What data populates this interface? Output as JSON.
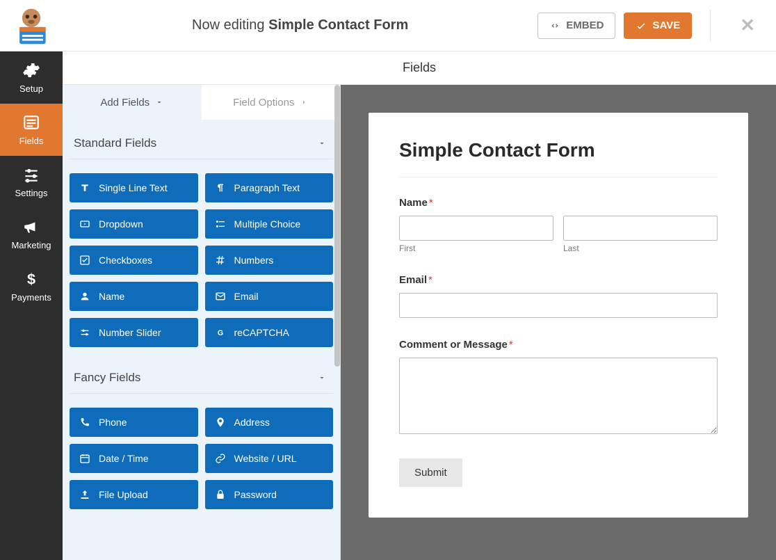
{
  "header": {
    "editing_prefix": "Now editing",
    "form_name": "Simple Contact Form",
    "embed_label": "EMBED",
    "save_label": "SAVE"
  },
  "vnav": {
    "items": [
      {
        "label": "Setup"
      },
      {
        "label": "Fields"
      },
      {
        "label": "Settings"
      },
      {
        "label": "Marketing"
      },
      {
        "label": "Payments"
      }
    ],
    "active_index": 1
  },
  "subheader": {
    "title": "Fields"
  },
  "side": {
    "tabs": [
      {
        "label": "Add Fields"
      },
      {
        "label": "Field Options"
      }
    ],
    "active_tab": 0,
    "groups": [
      {
        "title": "Standard Fields",
        "fields": [
          {
            "label": "Single Line Text",
            "icon": "text-icon"
          },
          {
            "label": "Paragraph Text",
            "icon": "paragraph-icon"
          },
          {
            "label": "Dropdown",
            "icon": "dropdown-icon"
          },
          {
            "label": "Multiple Choice",
            "icon": "list-icon"
          },
          {
            "label": "Checkboxes",
            "icon": "check-icon"
          },
          {
            "label": "Numbers",
            "icon": "hash-icon"
          },
          {
            "label": "Name",
            "icon": "user-icon"
          },
          {
            "label": "Email",
            "icon": "mail-icon"
          },
          {
            "label": "Number Slider",
            "icon": "slider-icon"
          },
          {
            "label": "reCAPTCHA",
            "icon": "g-icon"
          }
        ]
      },
      {
        "title": "Fancy Fields",
        "fields": [
          {
            "label": "Phone",
            "icon": "phone-icon"
          },
          {
            "label": "Address",
            "icon": "pin-icon"
          },
          {
            "label": "Date / Time",
            "icon": "calendar-icon"
          },
          {
            "label": "Website / URL",
            "icon": "link-icon"
          },
          {
            "label": "File Upload",
            "icon": "upload-icon"
          },
          {
            "label": "Password",
            "icon": "lock-icon"
          }
        ]
      }
    ]
  },
  "preview": {
    "form_title": "Simple Contact Form",
    "name": {
      "label": "Name",
      "first_sub": "First",
      "last_sub": "Last",
      "required": true,
      "first_value": "",
      "last_value": ""
    },
    "email": {
      "label": "Email",
      "required": true,
      "value": ""
    },
    "comment": {
      "label": "Comment or Message",
      "required": true,
      "value": ""
    },
    "submit_label": "Submit"
  },
  "colors": {
    "accent": "#e27730",
    "field_button": "#0e6cba"
  }
}
